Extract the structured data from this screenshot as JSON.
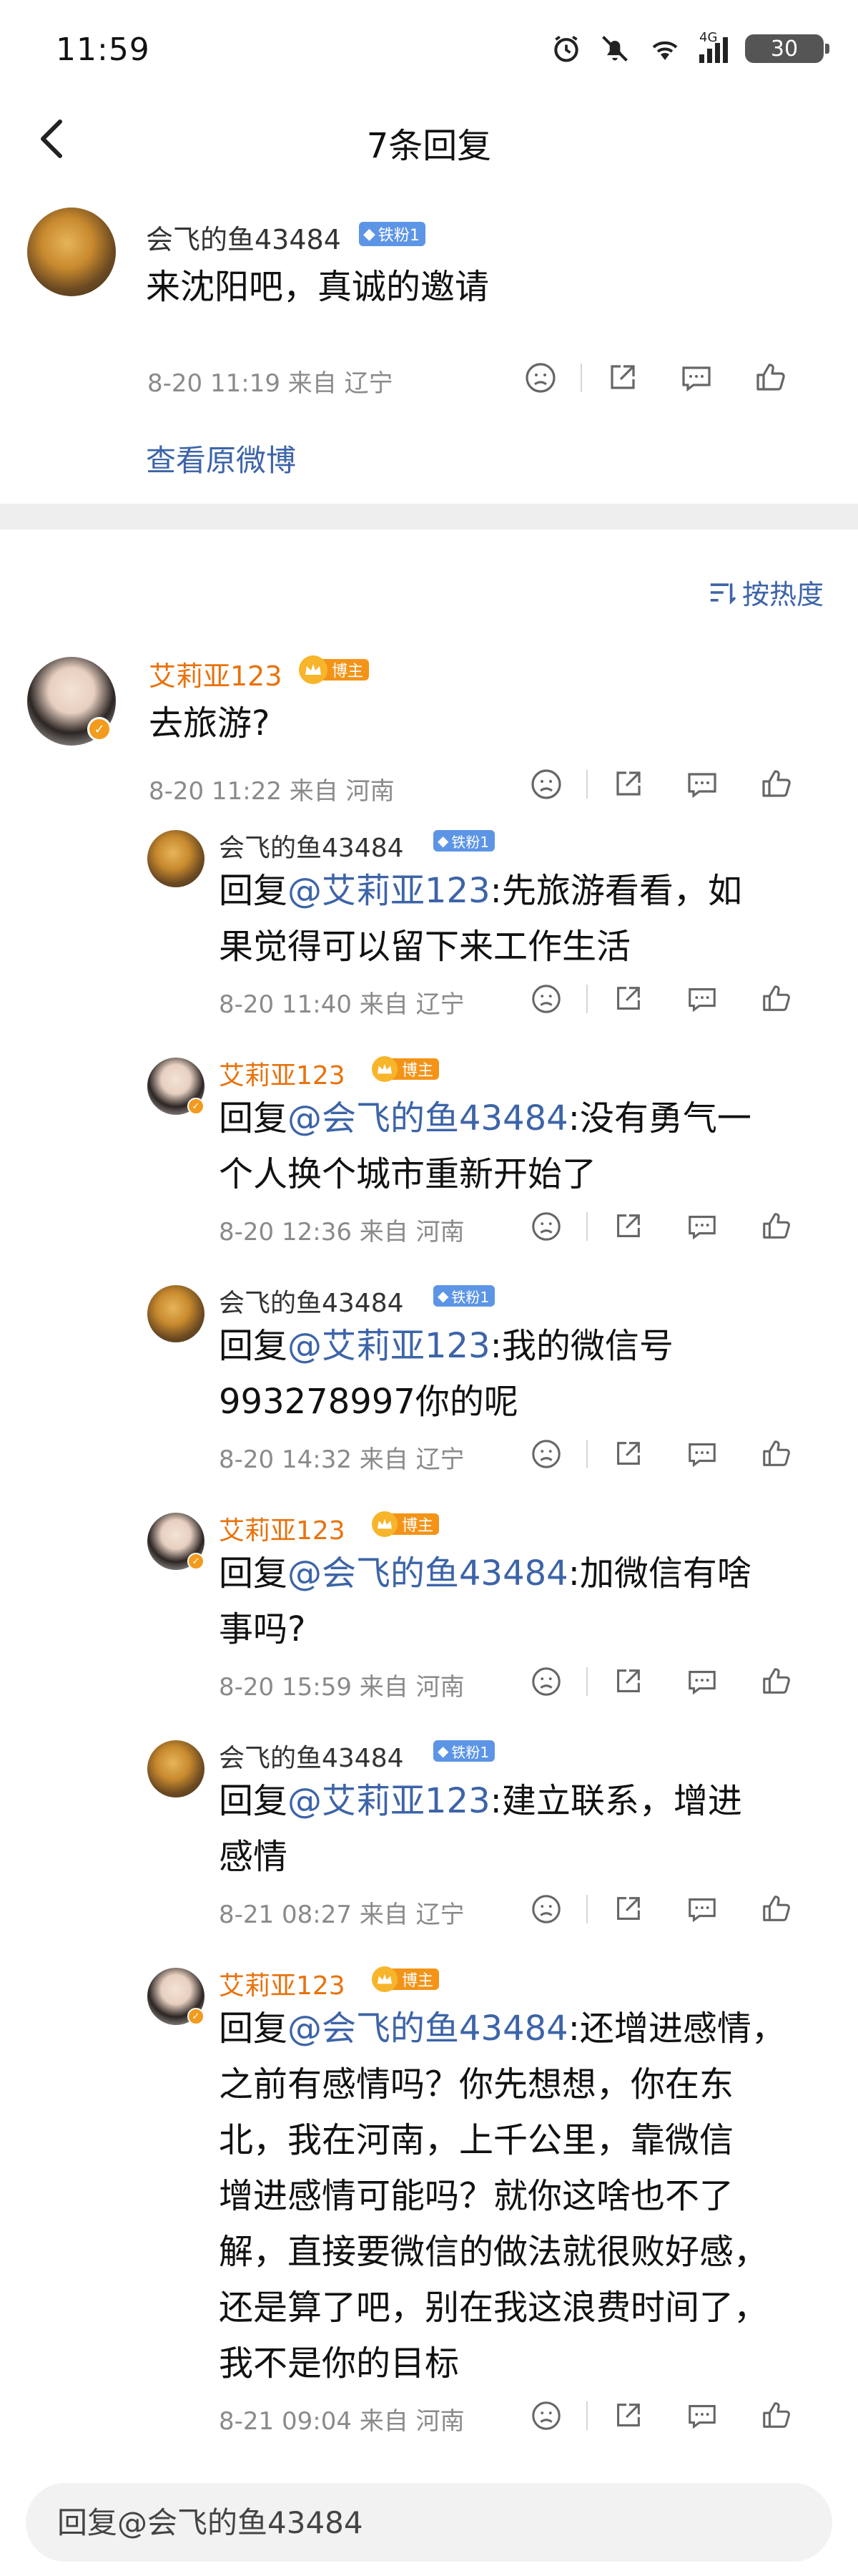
{
  "status": {
    "time": "11:59",
    "network": "4G",
    "battery": "30"
  },
  "nav": {
    "title": "7条回复"
  },
  "root_comment": {
    "user": "会飞的鱼43484",
    "fan_badge": "铁粉1",
    "text": "来沈阳吧，真诚的邀请",
    "meta": "8-20 11:19  来自 辽宁",
    "view_original": "查看原微博"
  },
  "sort": {
    "label": "按热度"
  },
  "main_reply": {
    "user": "艾莉亚123",
    "host_badge": "博主",
    "text": "去旅游?",
    "meta": "8-20 11:22  来自 河南"
  },
  "sub_replies": [
    {
      "user": "会飞的鱼43484",
      "badge": "铁粉1",
      "badge_type": "fan",
      "prefix": "回复",
      "at": "@艾莉亚123",
      "lines": [
        ":先旅游看看，如",
        "果觉得可以留下来工作生活"
      ],
      "meta": "8-20 11:40  来自 辽宁"
    },
    {
      "user": "艾莉亚123",
      "badge": "博主",
      "badge_type": "host",
      "prefix": "回复",
      "at": "@会飞的鱼43484",
      "lines": [
        ":没有勇气一",
        "个人换个城市重新开始了"
      ],
      "meta": "8-20 12:36  来自 河南"
    },
    {
      "user": "会飞的鱼43484",
      "badge": "铁粉1",
      "badge_type": "fan",
      "prefix": "回复",
      "at": "@艾莉亚123",
      "lines": [
        ":我的微信号",
        "993278997你的呢"
      ],
      "meta": "8-20 14:32  来自 辽宁"
    },
    {
      "user": "艾莉亚123",
      "badge": "博主",
      "badge_type": "host",
      "prefix": "回复",
      "at": "@会飞的鱼43484",
      "lines": [
        ":加微信有啥",
        "事吗?"
      ],
      "meta": "8-20 15:59  来自 河南"
    },
    {
      "user": "会飞的鱼43484",
      "badge": "铁粉1",
      "badge_type": "fan",
      "prefix": "回复",
      "at": "@艾莉亚123",
      "lines": [
        ":建立联系，增进",
        "感情"
      ],
      "meta": "8-21 08:27  来自 辽宁"
    },
    {
      "user": "艾莉亚123",
      "badge": "博主",
      "badge_type": "host",
      "prefix": "回复",
      "at": "@会飞的鱼43484",
      "lines": [
        ":还增进感情，",
        "之前有感情吗？你先想想，你在东",
        "北，我在河南，上千公里，靠微信",
        "增进感情可能吗？就你这啥也不了",
        "解，直接要微信的做法就很败好感，",
        "还是算了吧，别在我这浪费时间了，",
        "我不是你的目标"
      ],
      "meta": "8-21 09:04  来自 河南"
    }
  ],
  "reply_input": {
    "placeholder": "回复@会飞的鱼43484"
  },
  "colors": {
    "link": "#3d64a8",
    "host_name": "#e8720c",
    "fan_badge": "#5d95e6",
    "host_badge": "#f39418"
  },
  "icons": [
    "back-arrow-icon",
    "dislike-icon",
    "share-icon",
    "comment-icon",
    "like-icon",
    "sort-icon",
    "alarm-icon",
    "mute-icon",
    "wifi-icon",
    "signal-icon"
  ]
}
